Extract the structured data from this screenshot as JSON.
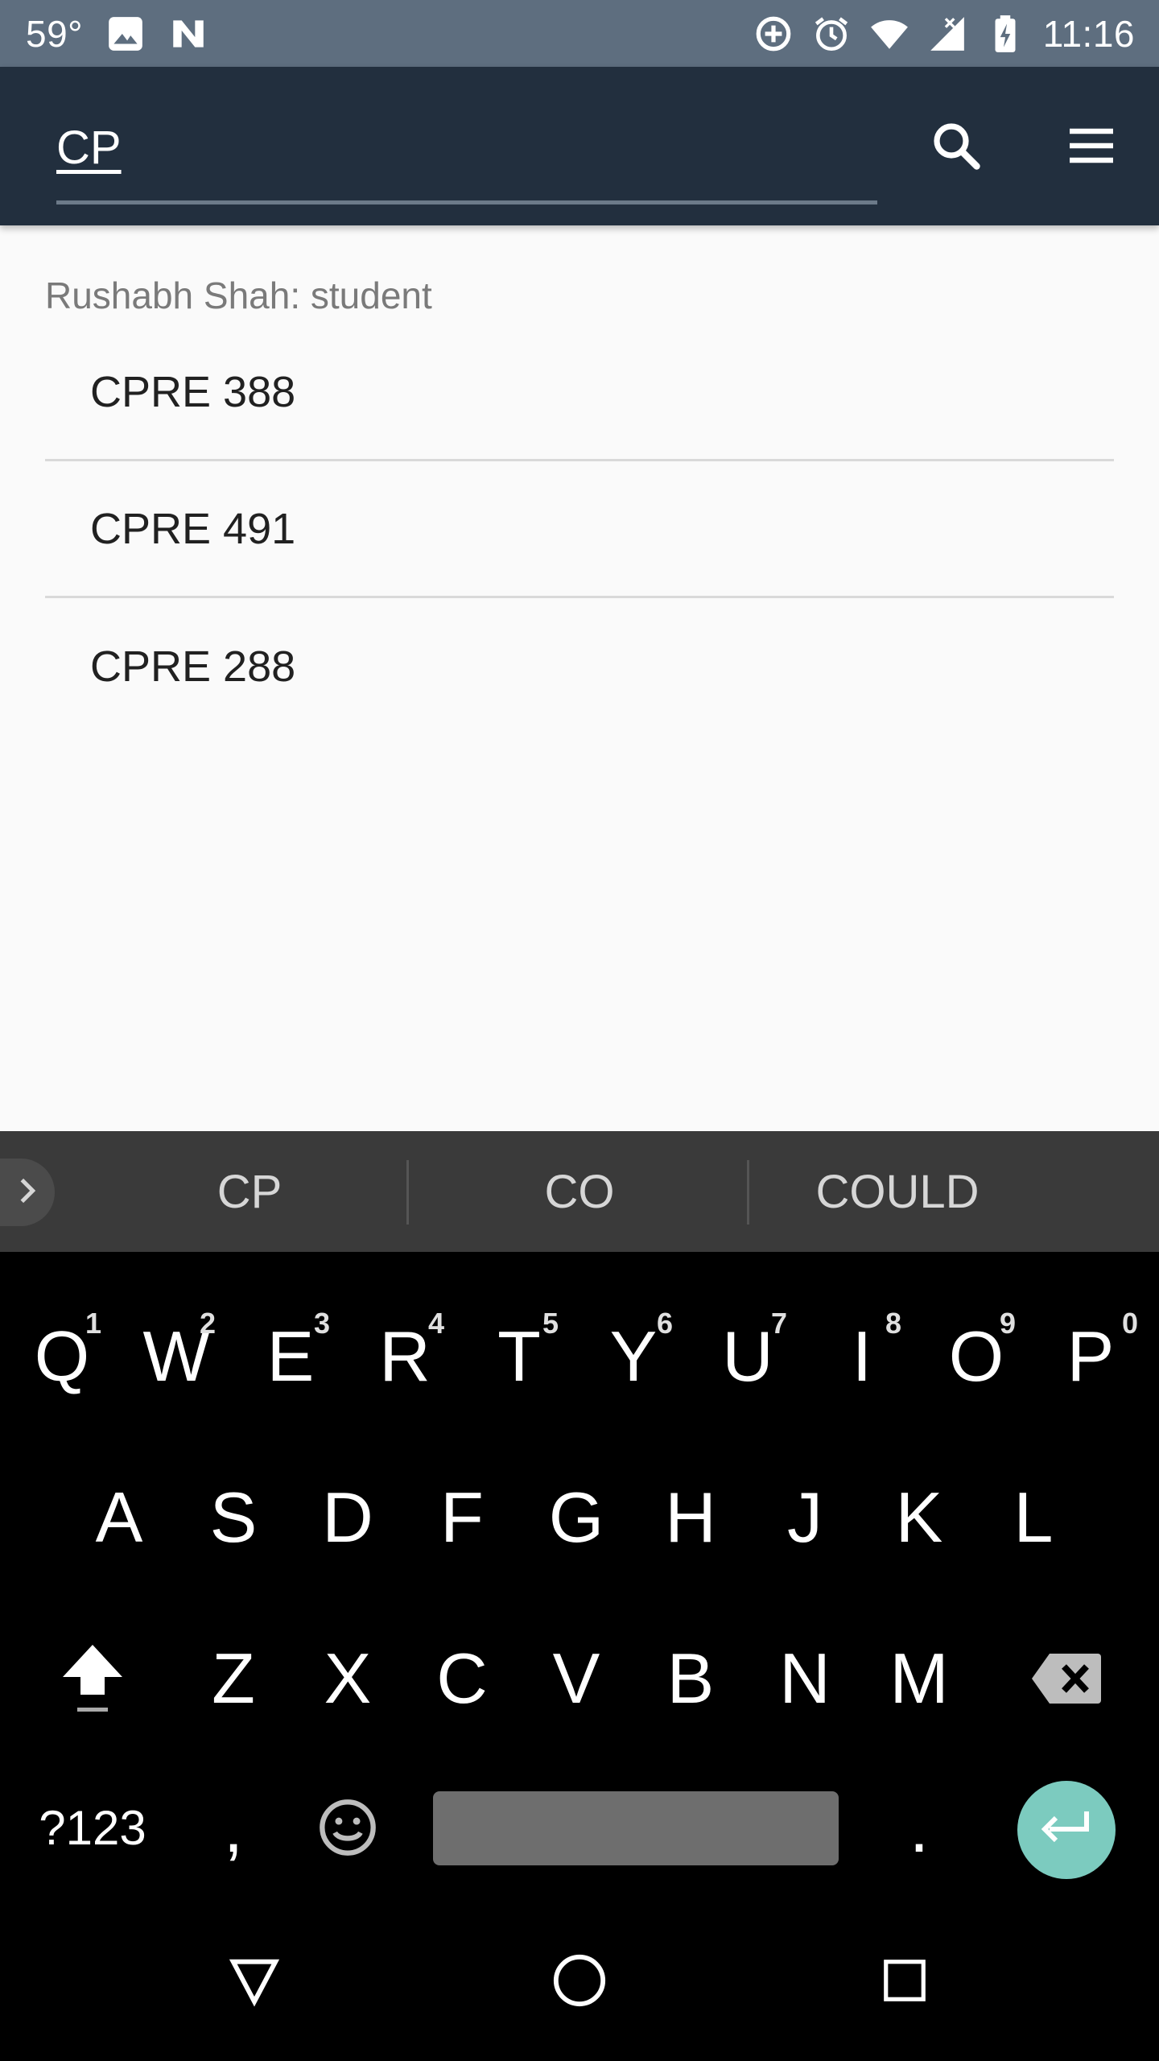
{
  "status_bar": {
    "temperature": "59°",
    "time": "11:16",
    "icons": [
      "image-icon",
      "n-icon",
      "data-saver-icon",
      "alarm-icon",
      "wifi-icon",
      "signal-icon",
      "battery-charging-icon"
    ]
  },
  "toolbar": {
    "search_value": "CP",
    "icons": [
      "search-icon",
      "menu-icon"
    ]
  },
  "content": {
    "user_label": "Rushabh Shah: student",
    "courses": [
      "CPRE 388",
      "CPRE 491",
      "CPRE 288"
    ]
  },
  "suggestions": [
    "CP",
    "CO",
    "COULD"
  ],
  "keyboard": {
    "row1": [
      {
        "key": "Q",
        "hint": "1"
      },
      {
        "key": "W",
        "hint": "2"
      },
      {
        "key": "E",
        "hint": "3"
      },
      {
        "key": "R",
        "hint": "4"
      },
      {
        "key": "T",
        "hint": "5"
      },
      {
        "key": "Y",
        "hint": "6"
      },
      {
        "key": "U",
        "hint": "7"
      },
      {
        "key": "I",
        "hint": "8"
      },
      {
        "key": "O",
        "hint": "9"
      },
      {
        "key": "P",
        "hint": "0"
      }
    ],
    "row2": [
      "A",
      "S",
      "D",
      "F",
      "G",
      "H",
      "J",
      "K",
      "L"
    ],
    "row3": [
      "Z",
      "X",
      "C",
      "V",
      "B",
      "N",
      "M"
    ],
    "symbols_label": "?123",
    "comma": ",",
    "period": ".",
    "accent_color": "#7ccbbf"
  },
  "nav_bar": {
    "icons": [
      "back-icon",
      "home-icon",
      "recents-icon"
    ]
  }
}
